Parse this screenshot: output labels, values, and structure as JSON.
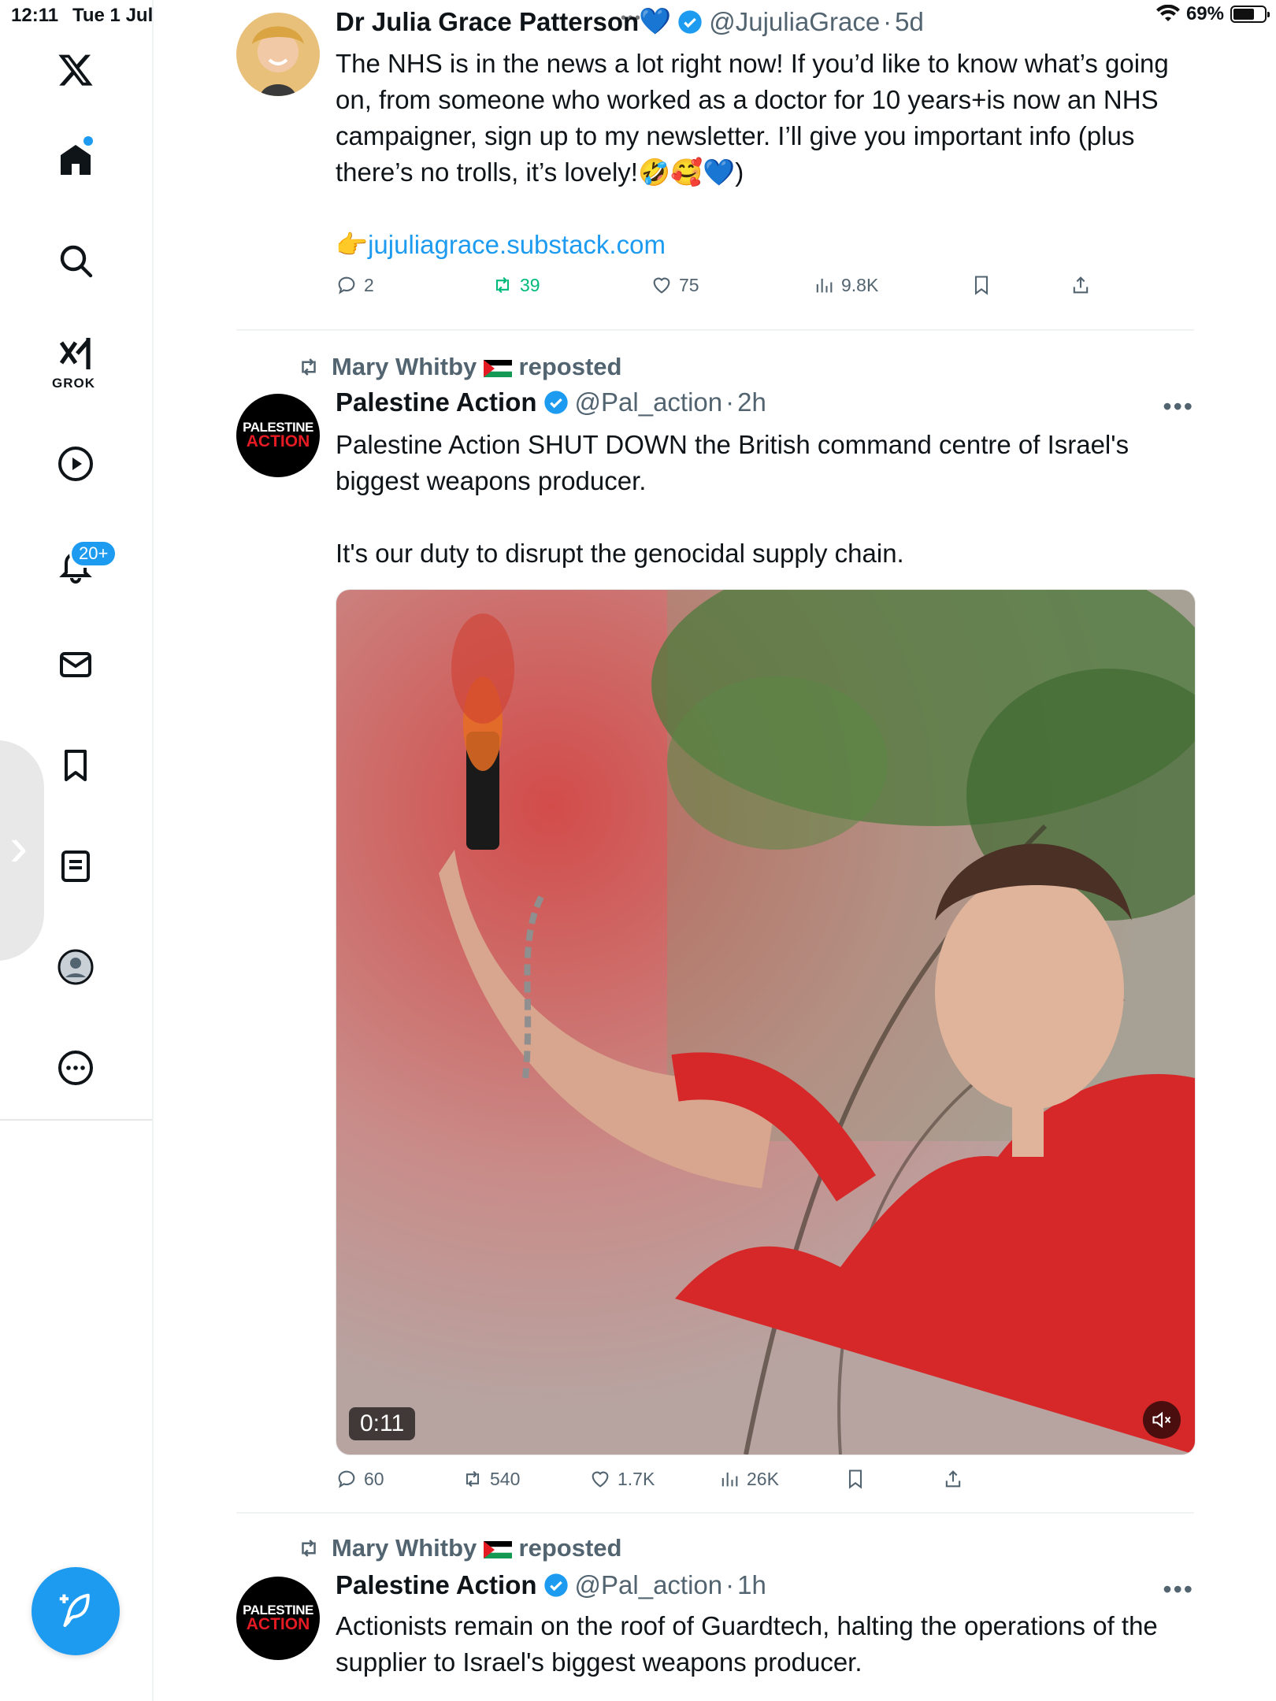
{
  "status_bar": {
    "time": "12:11",
    "date": "Tue 1 Jul",
    "battery": "69%",
    "battery_level": 0.69
  },
  "sidebar": {
    "grok_label": "GROK",
    "notifications_badge": "20+"
  },
  "posts": [
    {
      "author": "Dr Julia Grace Patterson",
      "author_emoji": "💙",
      "handle": "@JujuliaGrace",
      "time": "5d",
      "text": "The NHS is in the news a lot right now! If you’d like to know what’s going on, from someone who worked as a doctor for 10 years+is now an NHS campaigner, sign up to my newsletter. I’ll give you important info (plus there’s no trolls, it’s lovely!🤣🥰💙)",
      "link_prefix": "👉",
      "link": "jujuliagrace.substack.com",
      "replies": "2",
      "reposts": "39",
      "likes": "75",
      "views": "9.8K"
    },
    {
      "reposted_by": "Mary Whitby",
      "reposted_label": "reposted",
      "author": "Palestine Action",
      "handle": "@Pal_action",
      "time": "2h",
      "logo_line1": "PALESTINE",
      "logo_line2": "ACTION",
      "text": "Palestine Action SHUT DOWN the British command centre of Israel's biggest weapons producer.\n\nIt's our duty to disrupt the genocidal supply chain.",
      "video_time": "0:11",
      "replies": "60",
      "reposts": "540",
      "likes": "1.7K",
      "views": "26K"
    },
    {
      "reposted_by": "Mary Whitby",
      "reposted_label": "reposted",
      "author": "Palestine Action",
      "handle": "@Pal_action",
      "time": "1h",
      "logo_line1": "PALESTINE",
      "logo_line2": "ACTION",
      "text": "Actionists remain on the roof of Guardtech, halting the operations of the supplier to Israel's biggest weapons producer."
    }
  ],
  "colors": {
    "accent": "#1d9bf0",
    "muted": "#536471",
    "repost_active": "#00ba7c",
    "brand_red": "#e41b23"
  }
}
